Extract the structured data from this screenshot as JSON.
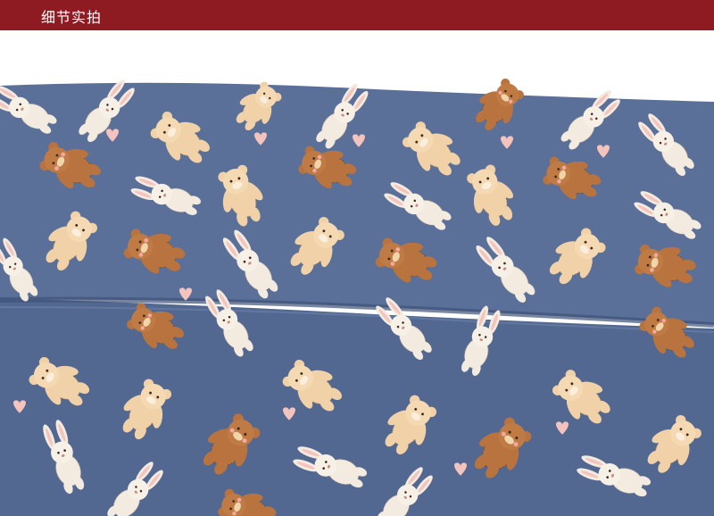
{
  "header": {
    "title": "细节实拍",
    "background_color": "#8f1b22",
    "text_color": "#ffffff"
  },
  "photo": {
    "subject": "fabric",
    "fabric_color": "#566d96",
    "motifs": [
      "teddy-bear",
      "bunny",
      "heart"
    ],
    "motif_colors": [
      "#b8733f",
      "#f1d2a8",
      "#f3ebe0",
      "#f4c3bd"
    ]
  }
}
